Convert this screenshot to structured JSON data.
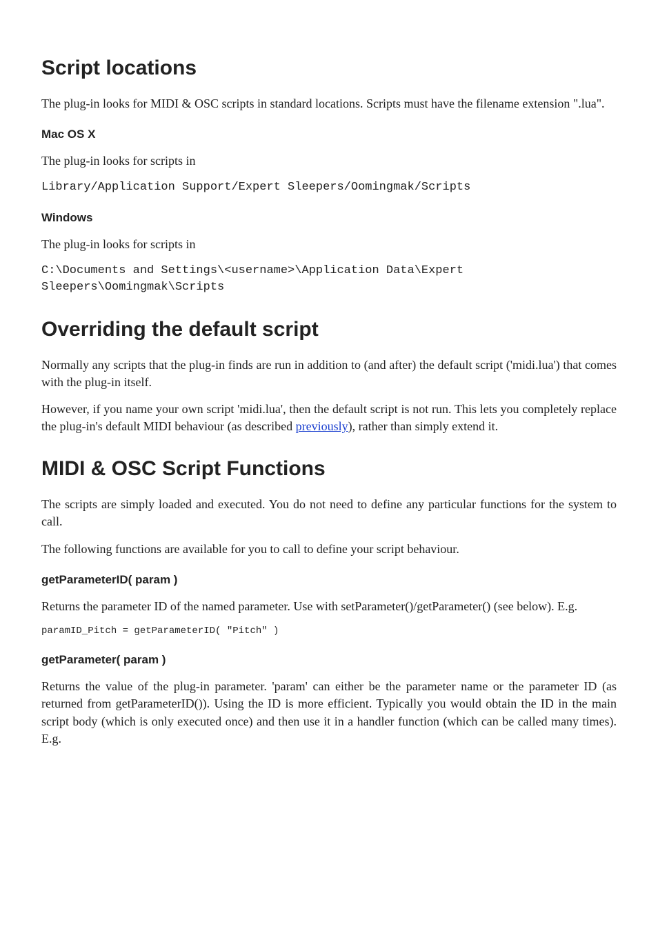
{
  "sections": {
    "script_locations": {
      "heading": "Script locations",
      "intro": "The plug-in looks for MIDI & OSC scripts in standard locations. Scripts must have the filename extension \".lua\".",
      "mac": {
        "title": "Mac OS X",
        "text": "The plug-in looks for scripts in",
        "path": "Library/Application Support/Expert Sleepers/Oomingmak/Scripts"
      },
      "windows": {
        "title": "Windows",
        "text": "The plug-in looks for scripts in",
        "path": "C:\\Documents and Settings\\<username>\\Application Data\\Expert Sleepers\\Oomingmak\\Scripts"
      }
    },
    "overriding": {
      "heading": "Overriding the default script",
      "p1": "Normally any scripts that the plug-in finds are run in addition to (and after) the default script ('midi.lua') that comes with the plug-in itself.",
      "p2_before": "However, if you name your own script 'midi.lua', then the default script is not run. This lets you completely replace the plug-in's default MIDI behaviour (as described ",
      "p2_link": "previously",
      "p2_after": "), rather than simply extend it."
    },
    "functions": {
      "heading": "MIDI & OSC Script Functions",
      "p1": "The scripts are simply loaded and executed. You do not need to define any particular functions for the system to call.",
      "p2": "The following functions are available for you to call to define your script behaviour.",
      "getParameterID": {
        "title": "getParameterID( param )",
        "text": "Returns the parameter ID of the named parameter. Use with setParameter()/getParameter() (see below). E.g.",
        "code": "paramID_Pitch = getParameterID( \"Pitch\" )"
      },
      "getParameter": {
        "title": "getParameter( param )",
        "text": "Returns the value of the plug-in parameter. 'param' can either be the parameter name or the parameter ID (as returned from getParameterID()). Using the ID is more efficient. Typically you would obtain the ID in the main script body (which is only executed once) and then use it in a handler function (which can be called many times). E.g."
      }
    }
  }
}
